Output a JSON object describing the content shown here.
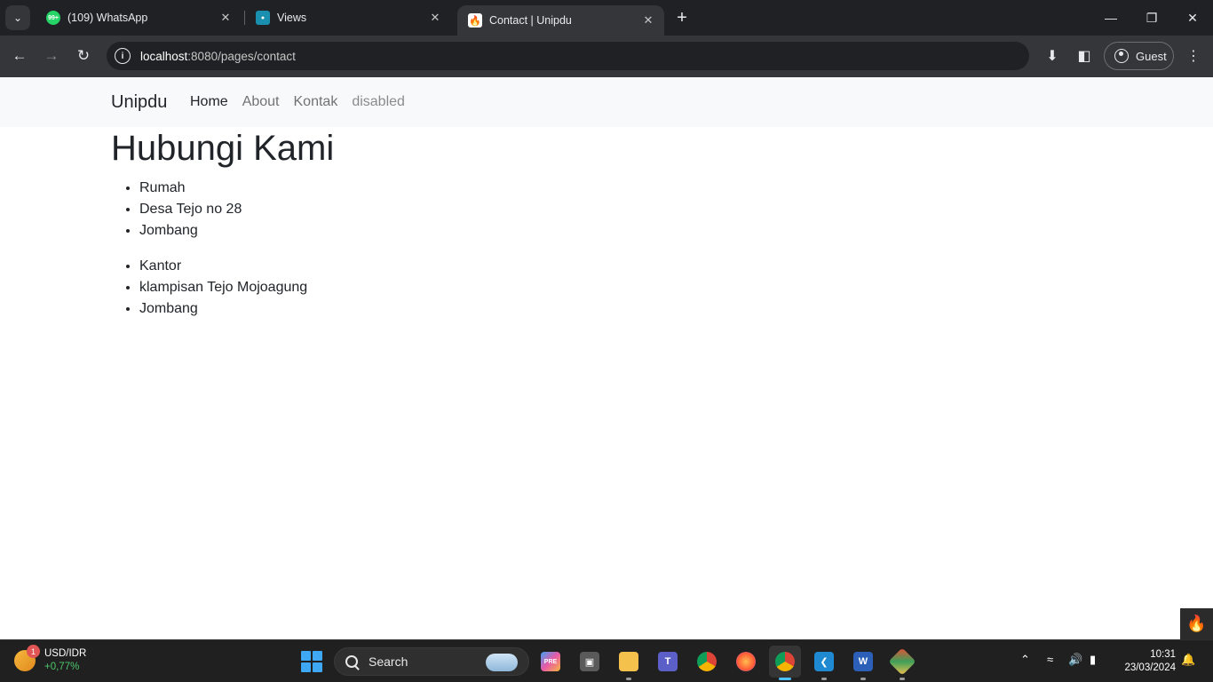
{
  "browser": {
    "tabs": [
      {
        "title": "(109) WhatsApp",
        "favicon": "whatsapp-icon",
        "color": "#25d366",
        "badge": "99+"
      },
      {
        "title": "Views",
        "favicon": "views-icon",
        "color": "#1a8fb0"
      },
      {
        "title": "Contact | Unipdu",
        "favicon": "codeigniter-icon",
        "color": "#dd4814",
        "active": true
      }
    ],
    "url_host": "localhost",
    "url_path": ":8080/pages/contact",
    "profile_label": "Guest"
  },
  "site": {
    "brand": "Unipdu",
    "nav": [
      "Home",
      "About",
      "Kontak",
      "disabled"
    ],
    "heading": "Hubungi Kami",
    "lists": [
      [
        "Rumah",
        "Desa Tejo no 28",
        "Jombang"
      ],
      [
        "Kantor",
        "klampisan Tejo Mojoagung",
        "Jombang"
      ]
    ]
  },
  "taskbar": {
    "weather_title": "USD/IDR",
    "weather_value": "+0,77%",
    "weather_badge": "1",
    "search_placeholder": "Search",
    "time": "10:31",
    "date": "23/03/2024",
    "apps": [
      "copilot-icon",
      "task-view-icon",
      "file-explorer-icon",
      "teams-icon",
      "chrome-icon",
      "firefox-icon",
      "chrome-icon",
      "vscode-icon",
      "word-icon",
      "git-icon"
    ]
  }
}
